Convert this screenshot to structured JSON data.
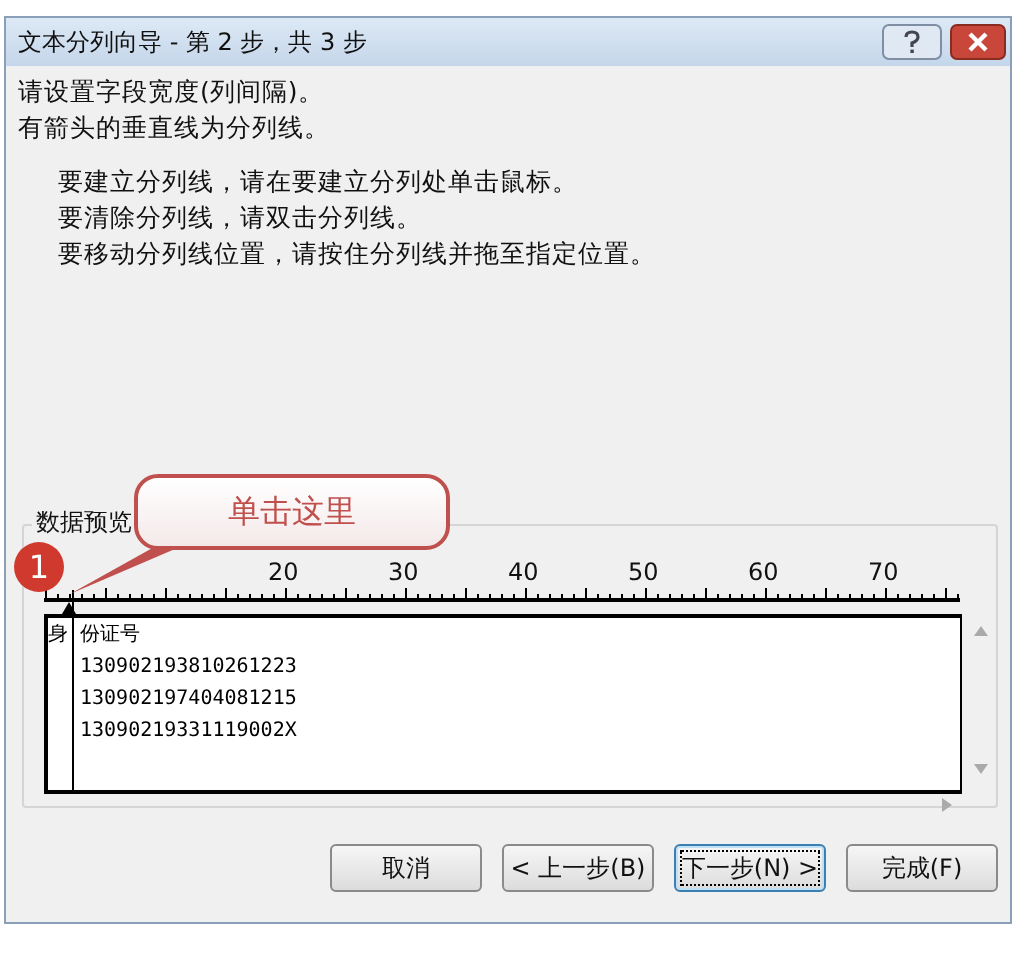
{
  "window": {
    "title": "文本分列向导 - 第 2 步，共 3 步"
  },
  "instructions": [
    "请设置字段宽度(列间隔)。",
    "有箭头的垂直线为分列线。"
  ],
  "hints": [
    "要建立分列线，请在要建立分列处单击鼠标。",
    "要清除分列线，请双击分列线。",
    "要移动分列线位置，请按住分列线并拖至指定位置。"
  ],
  "preview": {
    "label": "数据预览",
    "ruler": [
      "20",
      "30",
      "40",
      "50",
      "60",
      "70"
    ],
    "break_line": {
      "level": 0.026
    },
    "rows": [
      {
        "column_1": "身",
        "column_2": "份证号"
      },
      {
        "column_2": "130902193810261223"
      },
      {
        "column_2": "130902197404081215"
      },
      {
        "column_2": "13090219331119002X"
      }
    ]
  },
  "callout": {
    "number": "1",
    "text": "单击这里"
  },
  "buttons": [
    {
      "label": "取消",
      "focused": false
    },
    {
      "label": "< 上一步(B)",
      "focused": false
    },
    {
      "label": "下一步(N) >",
      "focused": true
    },
    {
      "label": "完成(F)",
      "focused": false
    }
  ]
}
